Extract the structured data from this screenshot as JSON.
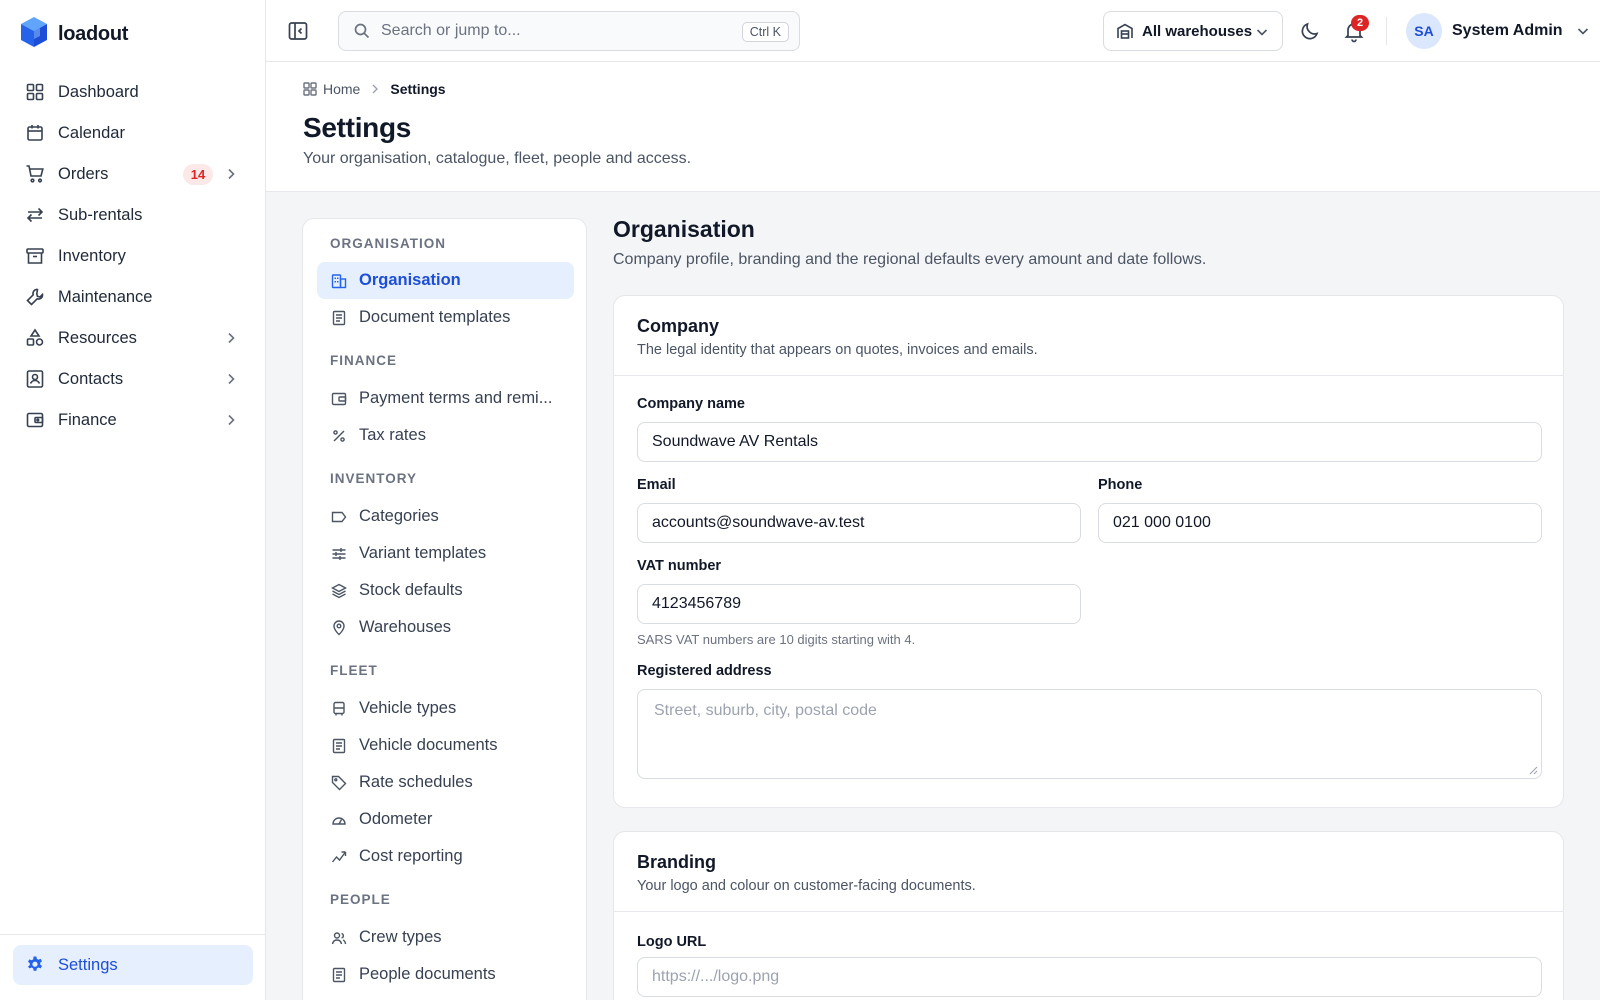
{
  "app": {
    "name": "loadout"
  },
  "sidebar": {
    "items": [
      {
        "label": "Dashboard",
        "icon": "dashboard-icon"
      },
      {
        "label": "Calendar",
        "icon": "calendar-icon"
      },
      {
        "label": "Orders",
        "icon": "cart-icon",
        "badge": "14",
        "chevron": true
      },
      {
        "label": "Sub-rentals",
        "icon": "swap-icon"
      },
      {
        "label": "Inventory",
        "icon": "archive-icon"
      },
      {
        "label": "Maintenance",
        "icon": "wrench-icon"
      },
      {
        "label": "Resources",
        "icon": "shapes-icon",
        "chevron": true
      },
      {
        "label": "Contacts",
        "icon": "contact-card-icon",
        "chevron": true
      },
      {
        "label": "Finance",
        "icon": "wallet-icon",
        "chevron": true
      }
    ],
    "settings_label": "Settings"
  },
  "topbar": {
    "search_placeholder": "Search or jump to...",
    "search_shortcut": "Ctrl K",
    "warehouse_select": "All warehouses",
    "notification_count": "2",
    "user_initials": "SA",
    "user_name": "System Admin"
  },
  "breadcrumb": {
    "home": "Home",
    "current": "Settings"
  },
  "page": {
    "title": "Settings",
    "subtitle": "Your organisation, catalogue, fleet, people and access."
  },
  "settings_nav": {
    "groups": {
      "organisation": "ORGANISATION",
      "finance": "FINANCE",
      "inventory": "INVENTORY",
      "fleet": "FLEET",
      "people": "PEOPLE"
    },
    "items": {
      "organisation": "Organisation",
      "document_templates": "Document templates",
      "payment_terms": "Payment terms and remi...",
      "tax_rates": "Tax rates",
      "categories": "Categories",
      "variant_templates": "Variant templates",
      "stock_defaults": "Stock defaults",
      "warehouses": "Warehouses",
      "vehicle_types": "Vehicle types",
      "vehicle_documents": "Vehicle documents",
      "rate_schedules": "Rate schedules",
      "odometer": "Odometer",
      "cost_reporting": "Cost reporting",
      "crew_types": "Crew types",
      "people_documents": "People documents"
    }
  },
  "section": {
    "title": "Organisation",
    "subtitle": "Company profile, branding and the regional defaults every amount and date follows."
  },
  "company_card": {
    "title": "Company",
    "description": "The legal identity that appears on quotes, invoices and emails.",
    "company_name_label": "Company name",
    "company_name_value": "Soundwave AV Rentals",
    "email_label": "Email",
    "email_value": "accounts@soundwave-av.test",
    "phone_label": "Phone",
    "phone_value": "021 000 0100",
    "vat_label": "VAT number",
    "vat_value": "4123456789",
    "vat_hint": "SARS VAT numbers are 10 digits starting with 4.",
    "address_label": "Registered address",
    "address_placeholder": "Street, suburb, city, postal code"
  },
  "branding_card": {
    "title": "Branding",
    "description": "Your logo and colour on customer-facing documents.",
    "logo_label": "Logo URL",
    "logo_placeholder": "https://.../logo.png"
  },
  "colors": {
    "accent": "#2563eb",
    "active_bg": "#e6effd",
    "badge_red": "#dc2626"
  }
}
